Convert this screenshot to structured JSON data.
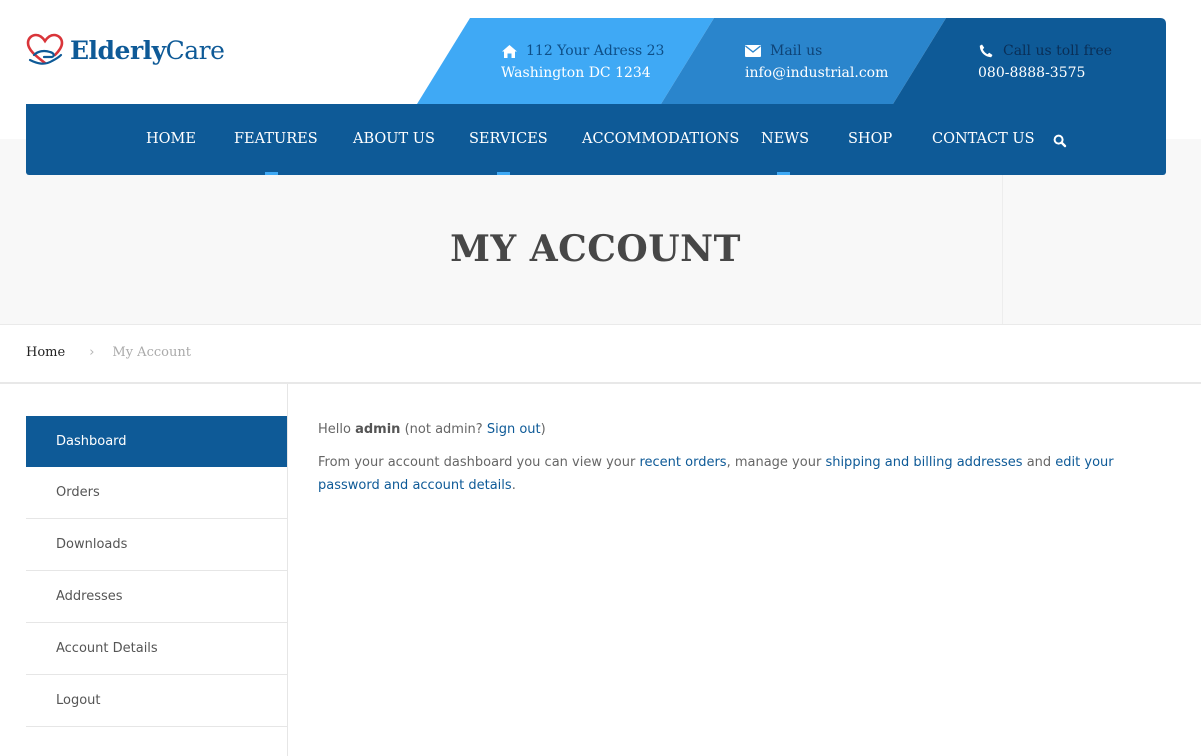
{
  "logo": {
    "bold": "Elderly",
    "light": "Care"
  },
  "contacts": [
    {
      "icon": "home-icon",
      "label": "112 Your Adress 23",
      "value": "Washington DC 1234"
    },
    {
      "icon": "mail-icon",
      "label": "Mail us",
      "value": "info@industrial.com"
    },
    {
      "icon": "phone-icon",
      "label": "Call us toll free",
      "value": "080-8888-3575"
    }
  ],
  "colors": {
    "brand": "#0e5a97",
    "light_blue": "#3fa9f5",
    "mid_blue": "#2a85cc",
    "dark_blue": "#0e5a97",
    "marker": "#3ea9f5"
  },
  "nav": {
    "items": [
      "HOME",
      "FEATURES",
      "ABOUT US",
      "SERVICES",
      "ACCOMMODATIONS",
      "NEWS",
      "SHOP",
      "CONTACT US"
    ],
    "active_markers": [
      "FEATURES",
      "SERVICES",
      "NEWS"
    ],
    "search_icon": "search-icon"
  },
  "page_title": "MY ACCOUNT",
  "breadcrumb": {
    "home": "Home",
    "separator": "›",
    "current": "My Account"
  },
  "sidebar": {
    "items": [
      "Dashboard",
      "Orders",
      "Downloads",
      "Addresses",
      "Account Details",
      "Logout"
    ],
    "active": "Dashboard"
  },
  "content": {
    "hello_prefix": "Hello ",
    "username": "admin",
    "not_text": " (not admin? ",
    "sign_out": "Sign out",
    "close_paren": ")",
    "dash_intro": "From your account dashboard you can view your ",
    "recent_orders": "recent orders",
    "manage_text": ", manage your ",
    "addresses_link": "shipping and billing addresses",
    "and_text": " and ",
    "account_link": "edit your password and account details",
    "period": "."
  }
}
